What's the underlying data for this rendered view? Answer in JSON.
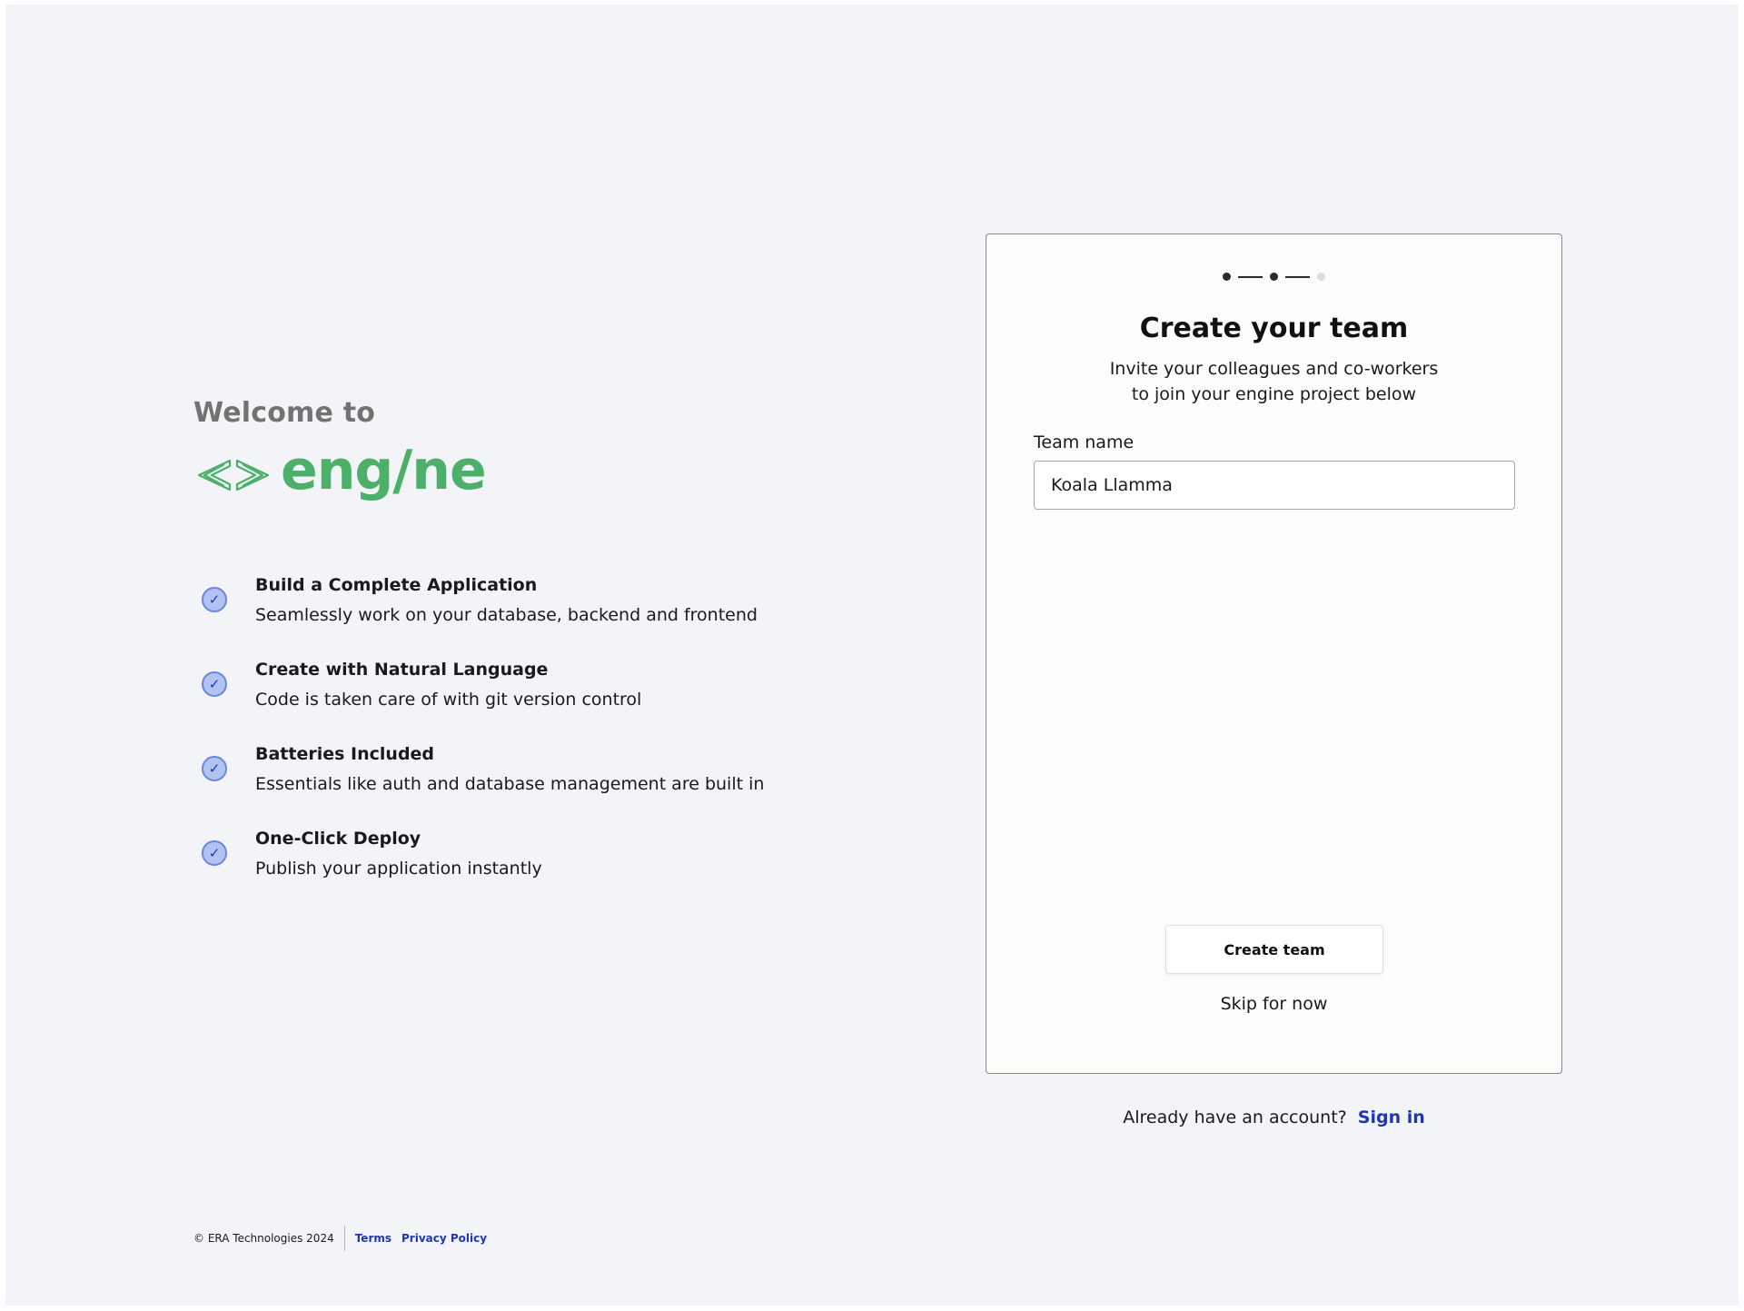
{
  "intro": {
    "welcome": "Welcome to",
    "logo_text": "eng/ne"
  },
  "features": [
    {
      "title": "Build a Complete Application",
      "desc": "Seamlessly work on your database, backend and frontend"
    },
    {
      "title": "Create with Natural Language",
      "desc": "Code is taken care of with git version control"
    },
    {
      "title": "Batteries Included",
      "desc": "Essentials like auth and database management are built in"
    },
    {
      "title": "One-Click Deploy",
      "desc": "Publish your application instantly"
    }
  ],
  "footer": {
    "copyright": "© ERA Technologies 2024",
    "terms": "Terms",
    "privacy": "Privacy Policy"
  },
  "card": {
    "steps_total": 3,
    "current_step": 2,
    "title": "Create your team",
    "subtitle_line1": "Invite your colleagues and co-workers",
    "subtitle_line2": "to join your engine project below",
    "team_label": "Team name",
    "team_value": "Koala Llamma",
    "create_button": "Create team",
    "skip": "Skip for now"
  },
  "signin": {
    "prompt": "Already have an account?",
    "link": "Sign in"
  },
  "colors": {
    "brand_green": "#4caf6a",
    "link_blue": "#1f37b7",
    "check_fill": "#b3c3f0"
  }
}
